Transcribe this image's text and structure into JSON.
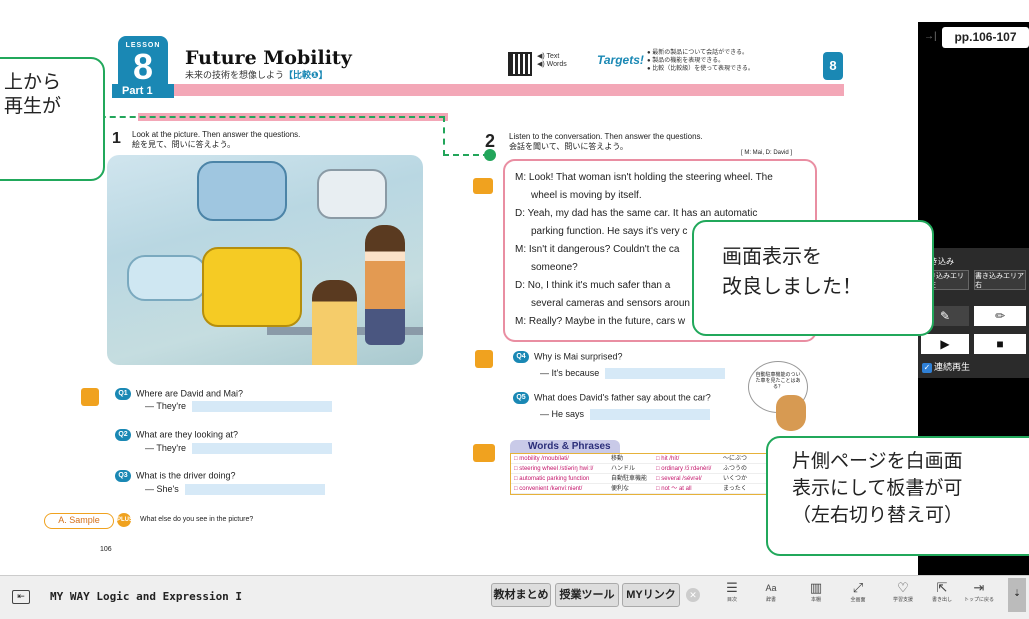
{
  "lesson": {
    "label": "LESSON",
    "number": "8",
    "title": "Future Mobility",
    "subtitle_jp": "未来の技術を想像しよう",
    "subtitle_tag": "【比較❶】",
    "part_label": "Part 1",
    "qr_text_line1": "◀) Text",
    "qr_text_line2": "◀) Words",
    "targets_label": "Targets!",
    "targets": [
      "● 最新の製品について会話ができる。",
      "● 製品の機能を表現できる。",
      "● 比較（比較級）を使って表現できる。"
    ],
    "section_badge": "8"
  },
  "left_page": {
    "q1_number": "1",
    "q1_en": "Look at the picture. Then answer the questions.",
    "q1_jp": "絵を見て、問いに答えよう。",
    "questions": [
      {
        "num": "Q1",
        "text": "Where are David and Mai?",
        "answer_prefix": "— They're"
      },
      {
        "num": "Q2",
        "text": "What are they looking at?",
        "answer_prefix": "— They're"
      },
      {
        "num": "Q3",
        "text": "What is the driver doing?",
        "answer_prefix": "— She's"
      }
    ],
    "sample_label": "A. Sample",
    "plus_label": "PLUS",
    "plus_text": "What else do you see in the picture?",
    "page_number": "106"
  },
  "right_page": {
    "q2_number": "2",
    "q2_en": "Listen to the conversation. Then answer the questions.",
    "q2_jp": "会話を聞いて、問いに答えよう。",
    "speakers": "[ M: Mai, D: David ]",
    "conversation": [
      "M: Look!  That woman isn't holding the steering wheel.  The",
      "wheel is moving by itself.",
      "D: Yeah, my dad has the same car.  It has an automatic",
      "parking function.  He says it's very c",
      "M: Isn't it dangerous?  Couldn't the ca",
      "someone?",
      "D: No, I think it's much safer than a",
      "several cameras and sensors aroun",
      "M: Really?  Maybe in the future, cars w"
    ],
    "q4_num": "Q4",
    "q4_text": "Why is Mai surprised?",
    "q4_answer": "— It's because",
    "q5_num": "Q5",
    "q5_text": "What does David's father say about the car?",
    "q5_answer": "— He says",
    "bubble_text": "自動駐車機能のついた車を見たことはある？",
    "words_title": "Words & Phrases",
    "words": [
      [
        "□ mobility /moubíləti/",
        "移動",
        "□ hit /hít/",
        "〜にぶつ"
      ],
      [
        "□ steering wheel /stíəriŋ hwìːl/",
        "ハンドル",
        "□ ordinary /ɔ́ːrdənèri/",
        "ふつうの"
      ],
      [
        "□ automatic parking function",
        "自動駐車機能",
        "□ several /sévrəl/",
        "いくつか"
      ],
      [
        "□ convenient /kənvíːniənt/",
        "便利な",
        "□ not 〜 at all",
        "まったく"
      ]
    ]
  },
  "callouts": {
    "top_left_line1": "上から",
    "top_left_line2": "再生が",
    "center_line1": "画面表示を",
    "center_line2": "改良しました！",
    "bottom_right_line1": "片側ページを白画面",
    "bottom_right_line2": "表示にして板書が可",
    "bottom_right_line3": "（左右切り替え可）"
  },
  "side_panel": {
    "page_range": "pp.106-107",
    "collapse_arrow": "→|",
    "writing_label": "書き込み",
    "btn_left": "書き込みエリア左",
    "btn_right": "書き込みエリア右",
    "continuous_play": "連続再生"
  },
  "footer": {
    "app_name": "MY WAY Logic and Expression I",
    "btn_summary": "教材まとめ",
    "btn_tools": "授業ツール",
    "btn_links": "MYリンク",
    "icons": [
      {
        "name": "toc-icon",
        "label": "目次",
        "glyph": "☰"
      },
      {
        "name": "dictionary-icon",
        "label": "辞書",
        "glyph": "Aa"
      },
      {
        "name": "bookshelf-icon",
        "label": "本棚",
        "glyph": "▥"
      },
      {
        "name": "fullscreen-icon",
        "label": "全画面",
        "glyph": "⤢"
      },
      {
        "name": "support-icon",
        "label": "学習支援",
        "glyph": "♡"
      },
      {
        "name": "export-icon",
        "label": "書き出し",
        "glyph": "⇱"
      },
      {
        "name": "top-icon",
        "label": "トップに戻る",
        "glyph": "⇥"
      }
    ]
  },
  "colors": {
    "accent": "#1a88b4",
    "pink": "#f3a7b7",
    "callout_border": "#21a85b",
    "orange": "#f0a21f"
  }
}
